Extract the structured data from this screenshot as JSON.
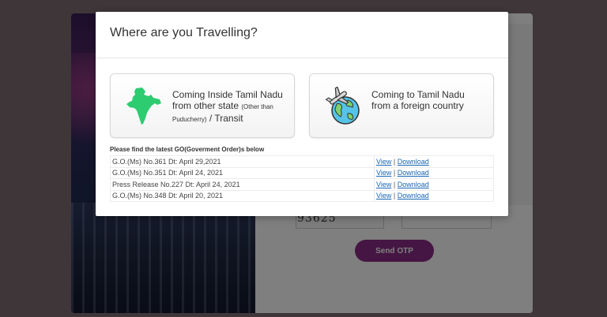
{
  "modal": {
    "title": "Where are you Travelling?",
    "option_inside": {
      "line1": "Coming Inside Tamil Nadu",
      "line2": "from other state",
      "note": "(Other than Puducherry)",
      "line3": "/ Transit",
      "icon": "india-map-icon"
    },
    "option_foreign": {
      "line1": "Coming to Tamil Nadu",
      "line2": "from a foreign country",
      "icon": "globe-airplane-icon"
    },
    "go_heading": "Please find the latest GO(Goverment Order)s below",
    "go_rows": [
      {
        "name": "G.O.(Ms) No.361 Dt: April 29,2021",
        "view": "View",
        "sep": "|",
        "download": "Download"
      },
      {
        "name": "G.O.(Ms) No.351 Dt: April 24, 2021",
        "view": "View",
        "sep": "|",
        "download": "Download"
      },
      {
        "name": "Press Release No.227 Dt: April 24, 2021",
        "view": "View",
        "sep": "|",
        "download": "Download"
      },
      {
        "name": "G.O.(Ms) No.348 Dt: April 20, 2021",
        "view": "View",
        "sep": "|",
        "download": "Download"
      }
    ]
  },
  "background": {
    "captcha_value": "93625",
    "send_otp_label": "Send OTP"
  },
  "colors": {
    "accent": "#8b2c87",
    "link": "#1a67b5",
    "india_map": "#2ecc71"
  }
}
